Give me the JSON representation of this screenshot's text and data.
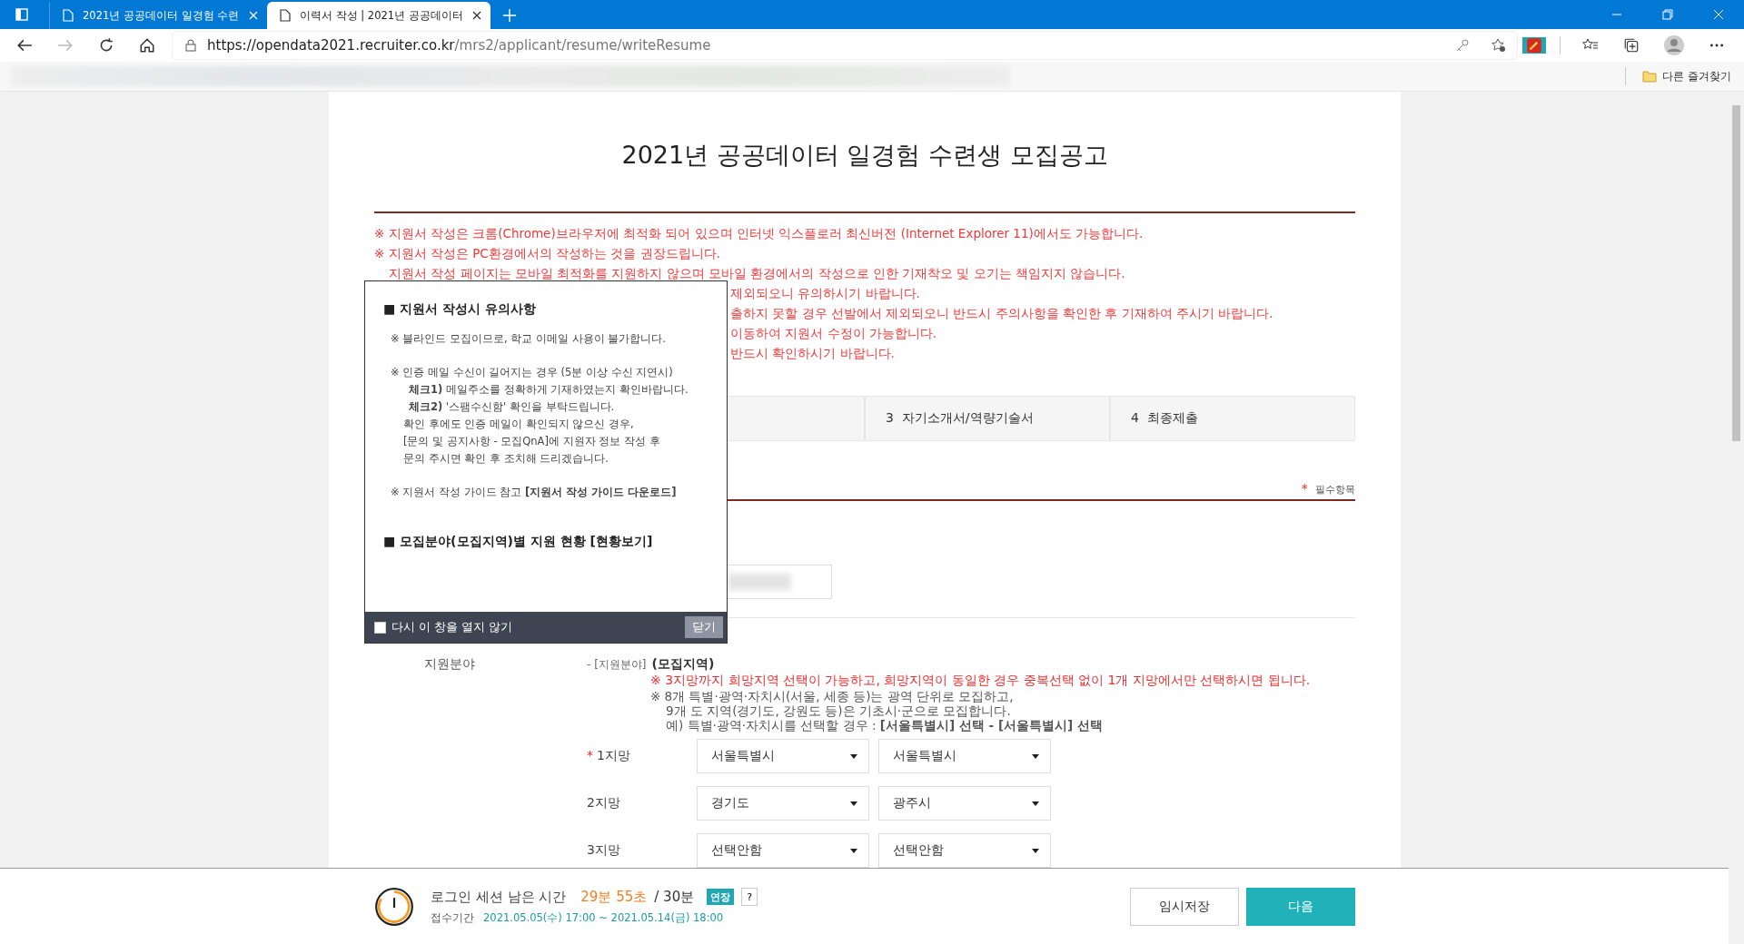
{
  "browser": {
    "tabs": [
      {
        "title": "2021년 공공데이터 일경험 수련",
        "selected": false
      },
      {
        "title": "이력서 작성 | 2021년 공공데이터",
        "selected": true
      }
    ],
    "url": {
      "host": "https://opendata2021.recruiter.co.kr",
      "path": "/mrs2/applicant/resume/writeResume"
    },
    "bookmark": "다른 즐겨찾기"
  },
  "page": {
    "title": "2021년 공공데이터 일경험 수련생 모집공고",
    "notices": [
      {
        "text": "※ 지원서 작성은 크롬(Chrome)브라우저에 최적화 되어 있으며 인터넷 익스플로러 최신버전 (Internet Explorer 11)에서도 가능합니다.",
        "kind": "mark"
      },
      {
        "text": "※ 지원서 작성은 PC환경에서의 작성하는 것을 권장드립니다.",
        "kind": "mark"
      },
      {
        "text": "지원서 작성 페이지는 모바일 최적화를 지원하지 않으며 모바일 환경에서의 작성으로 인한 기재착오 및 오기는 책임지지 않습니다.",
        "kind": "indent"
      },
      {
        "text": "제외되오니 유의하시기 바랍니다.",
        "kind": "partial"
      },
      {
        "text": "출하지 못할 경우 선발에서 제외되오니 반드시 주의사항을 확인한 후 기재하여 주시기 바랍니다.",
        "kind": "partial"
      },
      {
        "text": "이동하여 지원서 수정이 가능합니다.",
        "kind": "partial"
      },
      {
        "text": "반드시 확인하시기 바랍니다.",
        "kind": "partial"
      }
    ],
    "steps": [
      {
        "number": "3",
        "label": "자기소개서/역량기술서",
        "selected": false
      },
      {
        "number": "4",
        "label": "최종제출",
        "selected": false
      }
    ],
    "required_star": "*",
    "required_note": "필수항목",
    "field_label": "지원분야",
    "field_prefix": "- [지원분야]",
    "field_title": "(모집지역)",
    "warning": "※ 3지망까지 희망지역 선택이 가능하고, 희망지역이 동일한 경우 중복선택 없이 1개 지망에서만 선택하시면 됩니다.",
    "notes": [
      "※ 8개 특별·광역·자치시(서울, 세종 등)는 광역 단위로 모집하고,",
      "9개 도 지역(경기도, 강원도 등)은 기초시·군으로 모집합니다.",
      "예) 특별·광역·자치시를 선택할 경우 : **[서울특별시] 선택 - [서울특별시] 선택**"
    ],
    "choices": [
      {
        "label": "1지망",
        "mark": "*",
        "values": [
          "서울특별시",
          "서울특별시"
        ]
      },
      {
        "label": "2지망",
        "values": [
          "경기도",
          "광주시"
        ]
      },
      {
        "label": "3지망",
        "values": [
          "선택안함",
          "선택안함"
        ]
      }
    ]
  },
  "popup": {
    "sections": [
      {
        "heading": "■ 지원서 작성시 유의사항",
        "paragraphs": [
          [
            "※ 블라인드 모집이므로, 학교 이메일 사용이 불가합니다."
          ],
          [
            "※ 인증 메일 수신이 길어지는 경우 (5분 이상 수신 지연시)",
            "**체크1)** 메일주소를 정확하게 기재하였는지 확인바랍니다.",
            "**체크2)** '스팸수신함' 확인을 부탁드립니다.",
            "확인 후에도 인증 메일이 확인되지 않으신 경우,",
            "[문의 및 공지사항 - 모집QnA]에 지원자 정보 작성 후",
            "문의 주시면 확인 후 조치해 드리겠습니다."
          ],
          [
            "※ 지원서 작성 가이드 참고 **[지원서 작성 가이드 다운로드]**"
          ]
        ]
      },
      {
        "heading": "■ 모집분야(모집지역)별 지원 현황 [현황보기]"
      }
    ],
    "dont_show": {
      "label": "다시 이 창을 열지 않기",
      "checked": false
    },
    "close": "닫기"
  },
  "footer": {
    "session_label": "로그인 세션 남은 시간",
    "remaining": "29분 55초",
    "total": "/ 30분",
    "extend": "연장",
    "help": "?",
    "period_label": "접수기간",
    "period": "2021.05.05(수) 17:00 ~ 2021.05.14(금) 18:00",
    "save": "임시저장",
    "next": "다음"
  }
}
